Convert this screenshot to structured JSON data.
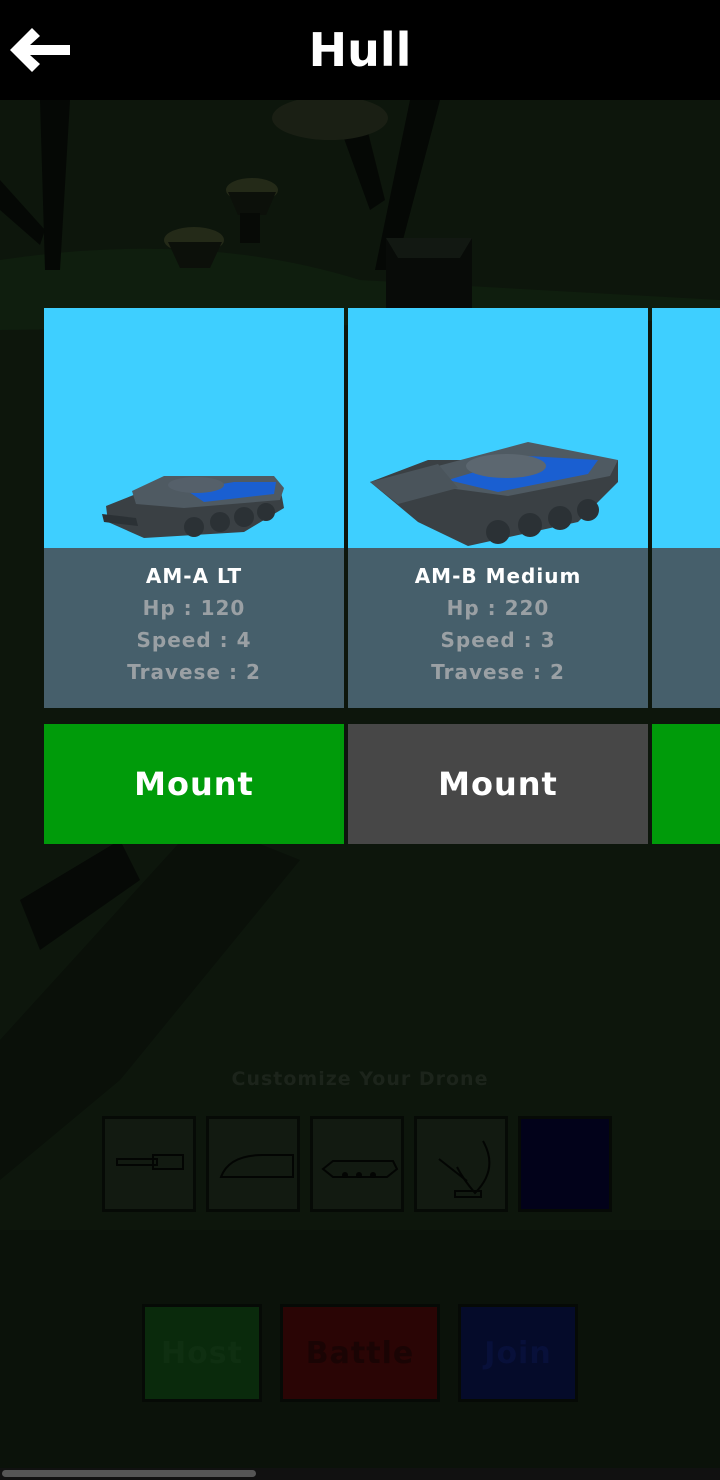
{
  "header": {
    "title": "Hull",
    "back_icon": "arrow-left-icon"
  },
  "cards": [
    {
      "name": "AM-A LT",
      "hp": "Hp : 120",
      "speed": "Speed : 4",
      "traverse": "Travese : 2",
      "mount_label": "Mount",
      "mount_color": "#009b0a"
    },
    {
      "name": "AM-B Medium",
      "hp": "Hp : 220",
      "speed": "Speed : 3",
      "traverse": "Travese : 2",
      "mount_label": "Mount",
      "mount_color": "#474747"
    },
    {
      "mount_color": "#009b0a"
    }
  ],
  "customize": {
    "label": "Customize Your Drone",
    "slots": [
      "gun-icon",
      "turret-icon",
      "hull-icon",
      "radar-dish-icon",
      "color-swatch"
    ]
  },
  "actions": {
    "host": "Host",
    "battle": "Battle",
    "join": "Join"
  },
  "colors": {
    "card_bg": "#3ecfff",
    "info_bg": "#465f6b",
    "tank_blue": "#1a5fd1"
  }
}
